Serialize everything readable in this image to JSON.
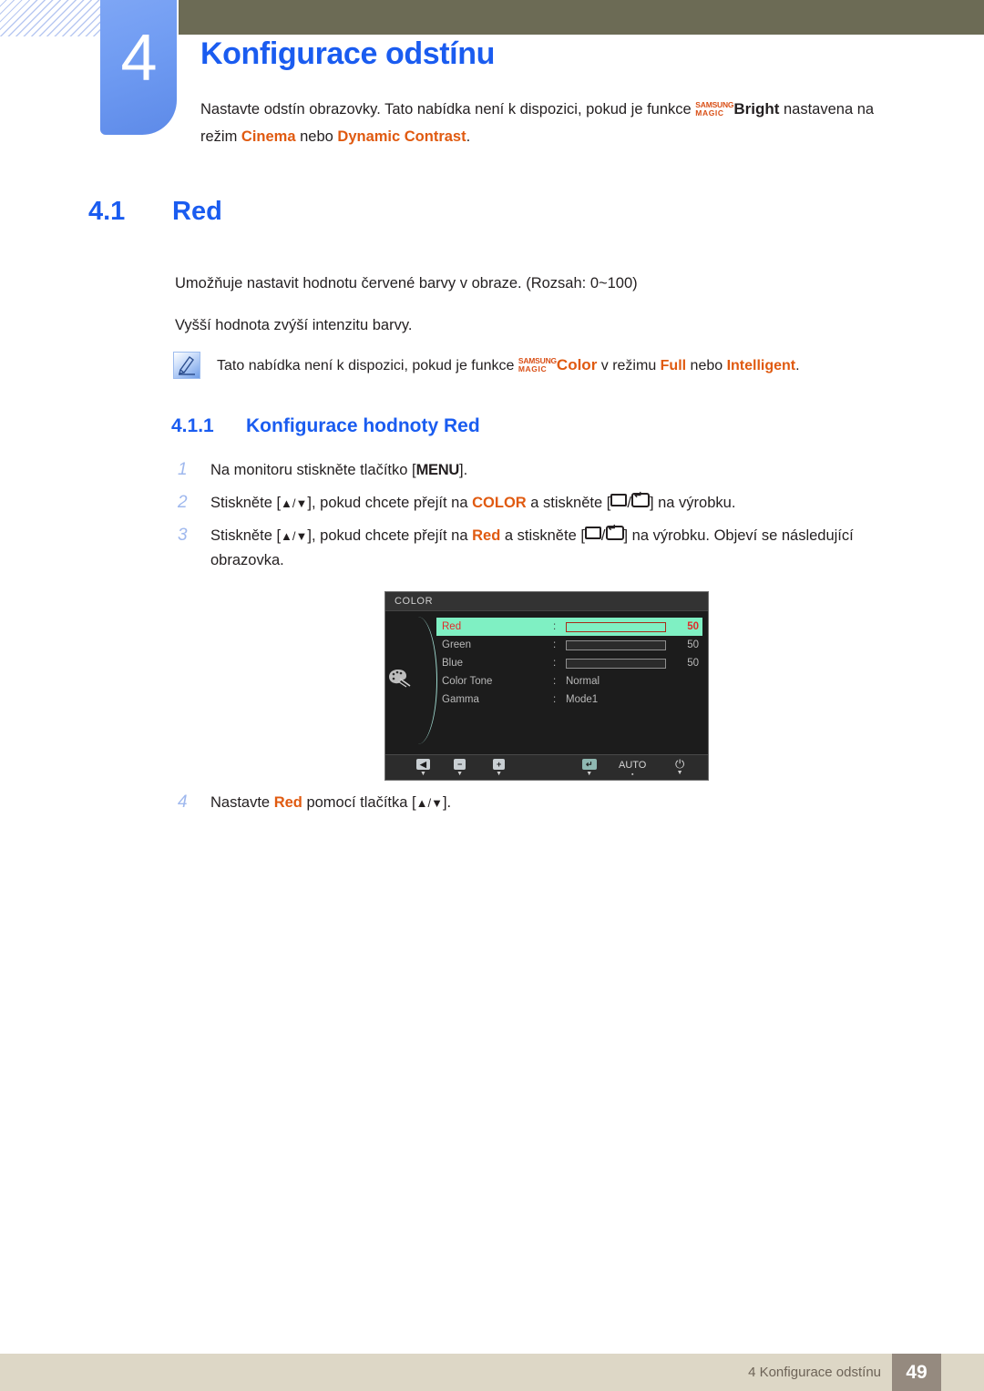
{
  "chapter": {
    "number": "4",
    "title": "Konfigurace odstínu",
    "intro_part1": "Nastavte odstín obrazovky. Tato nabídka není k dispozici, pokud je funkce ",
    "magic_top": "SAMSUNG",
    "magic_bottom": "MAGIC",
    "magic_word": "Bright",
    "intro_part2": " nastavena na režim ",
    "intro_mode1": "Cinema",
    "intro_joiner": " nebo ",
    "intro_mode2": "Dynamic Contrast",
    "intro_end": "."
  },
  "section": {
    "number": "4.1",
    "title": "Red",
    "paragraph1": "Umožňuje nastavit hodnotu červené barvy v obraze. (Rozsah: 0~100)",
    "paragraph2": "Vyšší hodnota zvýší intenzitu barvy."
  },
  "note": {
    "icon": "note-pencil-icon",
    "text_part1": "Tato nabídka není k dispozici, pokud je funkce ",
    "magic_top": "SAMSUNG",
    "magic_bottom": "MAGIC",
    "magic_word": "Color",
    "text_part2": " v režimu ",
    "mode1": "Full",
    "joiner": " nebo ",
    "mode2": "Intelligent",
    "text_end": "."
  },
  "subsection": {
    "number": "4.1.1",
    "title": "Konfigurace hodnoty Red"
  },
  "steps": [
    {
      "number": "1",
      "before": "Na monitoru stiskněte tlačítko [",
      "key": "MENU",
      "after": "]."
    },
    {
      "number": "2",
      "before": "Stiskněte [",
      "arrows": "▲/▼",
      "mid1": "], pokud chcete přejít na ",
      "highlight": "COLOR",
      "mid2": " a stiskněte [",
      "mid3": "/",
      "after": "] na výrobku."
    },
    {
      "number": "3",
      "before": "Stiskněte [",
      "arrows": "▲/▼",
      "mid1": "], pokud chcete přejít na ",
      "highlight": "Red",
      "mid2": " a stiskněte [",
      "mid3": "/",
      "after": "] na výrobku. Objeví se následující obrazovka."
    },
    {
      "number": "4",
      "before": "Nastavte ",
      "highlight": "Red",
      "mid1": " pomocí tlačítka [",
      "arrows": "▲/▼",
      "after": "]."
    }
  ],
  "osd": {
    "title": "COLOR",
    "palette_icon": "color-palette-icon",
    "rows": [
      {
        "label": "Red",
        "colon": ":",
        "type": "bar",
        "value": "50",
        "fill_pct": 50,
        "selected": true
      },
      {
        "label": "Green",
        "colon": ":",
        "type": "bar",
        "value": "50",
        "fill_pct": 50,
        "selected": false
      },
      {
        "label": "Blue",
        "colon": ":",
        "type": "bar",
        "value": "50",
        "fill_pct": 50,
        "selected": false
      },
      {
        "label": "Color Tone",
        "colon": ":",
        "type": "text",
        "value": "Normal",
        "selected": false
      },
      {
        "label": "Gamma",
        "colon": ":",
        "type": "text",
        "value": "Mode1",
        "selected": false
      }
    ],
    "buttons": [
      {
        "name": "back-button",
        "glyph": "◀",
        "style": "box",
        "tick": "▼"
      },
      {
        "name": "minus-button",
        "glyph": "−",
        "style": "box",
        "tick": "▼"
      },
      {
        "name": "plus-button",
        "glyph": "+",
        "style": "box",
        "tick": "▼"
      },
      {
        "name": "enter-button",
        "glyph": "↵",
        "style": "teal",
        "tick": "▼"
      },
      {
        "name": "auto-button",
        "glyph": "AUTO",
        "style": "text",
        "tick": "▪"
      },
      {
        "name": "power-button",
        "glyph": "⏻",
        "style": "text",
        "tick": "▼"
      }
    ],
    "colors": {
      "highlight": "#7ff0c3",
      "red_fill": "#f20000",
      "bar_gray": "#a8b0b0",
      "background": "#1c1c1c"
    }
  },
  "footer": {
    "text": "4 Konfigurace odstínu",
    "page": "49"
  },
  "theme": {
    "accent_blue": "#1a5cf0",
    "orange": "#e05a10",
    "header_olive": "#6c6b55",
    "footer_beige": "#ddd7c6",
    "page_box": "#958a7f"
  }
}
